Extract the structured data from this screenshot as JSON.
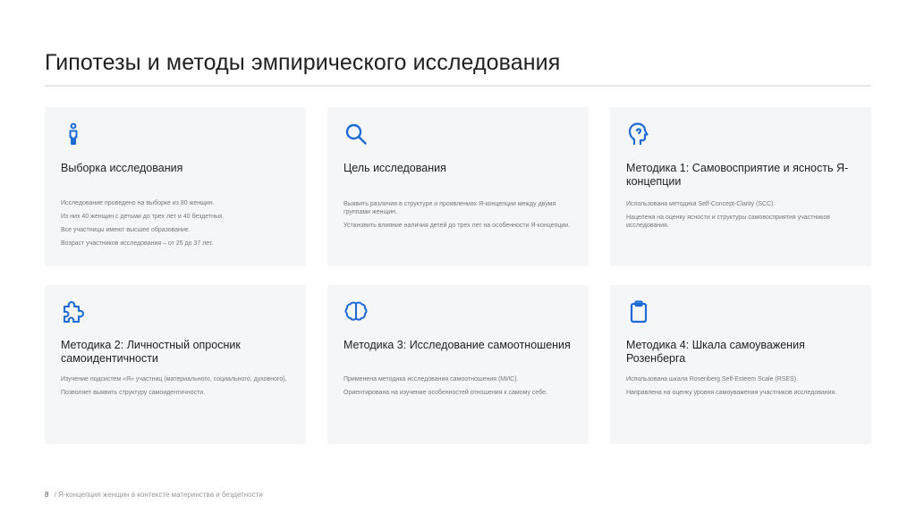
{
  "slide": {
    "title": "Гипотезы и методы эмпирического исследования",
    "footer": {
      "page_number": "8",
      "text": "/ Я-концепция женщин в контексте материнства и бездетности"
    }
  },
  "cards": [
    {
      "icon": "person-icon",
      "heading": "Выборка исследования",
      "paragraphs": [
        "Исследование проведено на выборке из 80 женщин.",
        "Из них 40 женщин с детьми до трех лет и 40 бездетных.",
        "Все участницы имеют высшее образование.",
        "Возраст участников исследования – от 25 до 37 лет."
      ]
    },
    {
      "icon": "search-icon",
      "heading": "Цель исследования",
      "paragraphs": [
        "Выявить различия в структуре и проявлениях Я-концепции между двумя группами женщин.",
        "Установить влияние наличия детей до трех лет на особенности Я-концепции."
      ]
    },
    {
      "icon": "head-profile-icon",
      "heading": "Методика 1: Самовосприятие и ясность Я-концепции",
      "paragraphs": [
        "Использована методика Self-Concept-Clarity (SCC).",
        "Нацелена на оценку ясности и структуры самовосприятия участников исследования."
      ]
    },
    {
      "icon": "puzzle-icon",
      "heading": "Методика 2: Личностный опросник самоидентичности",
      "paragraphs": [
        "Изучение подсистем «Я» участниц (материального, социального, духовного).",
        "Позволяет выявить структуру самоидентичности."
      ]
    },
    {
      "icon": "brain-icon",
      "heading": "Методика 3: Исследование самоотношения",
      "paragraphs": [
        "Применена методика исследования самоотношения (МИС).",
        "Ориентирована на изучение особенностей отношения к самому себе."
      ]
    },
    {
      "icon": "clipboard-icon",
      "heading": "Методика 4: Шкала самоуважения Розенберга",
      "paragraphs": [
        "Использована шкала Rosenberg Self-Esteem Scale (RSES).",
        "Направлена на оценку уровня самоуважения участников исследования."
      ]
    }
  ],
  "colors": {
    "accent": "#1e6bd6",
    "card_background": "#f5f6f8"
  }
}
